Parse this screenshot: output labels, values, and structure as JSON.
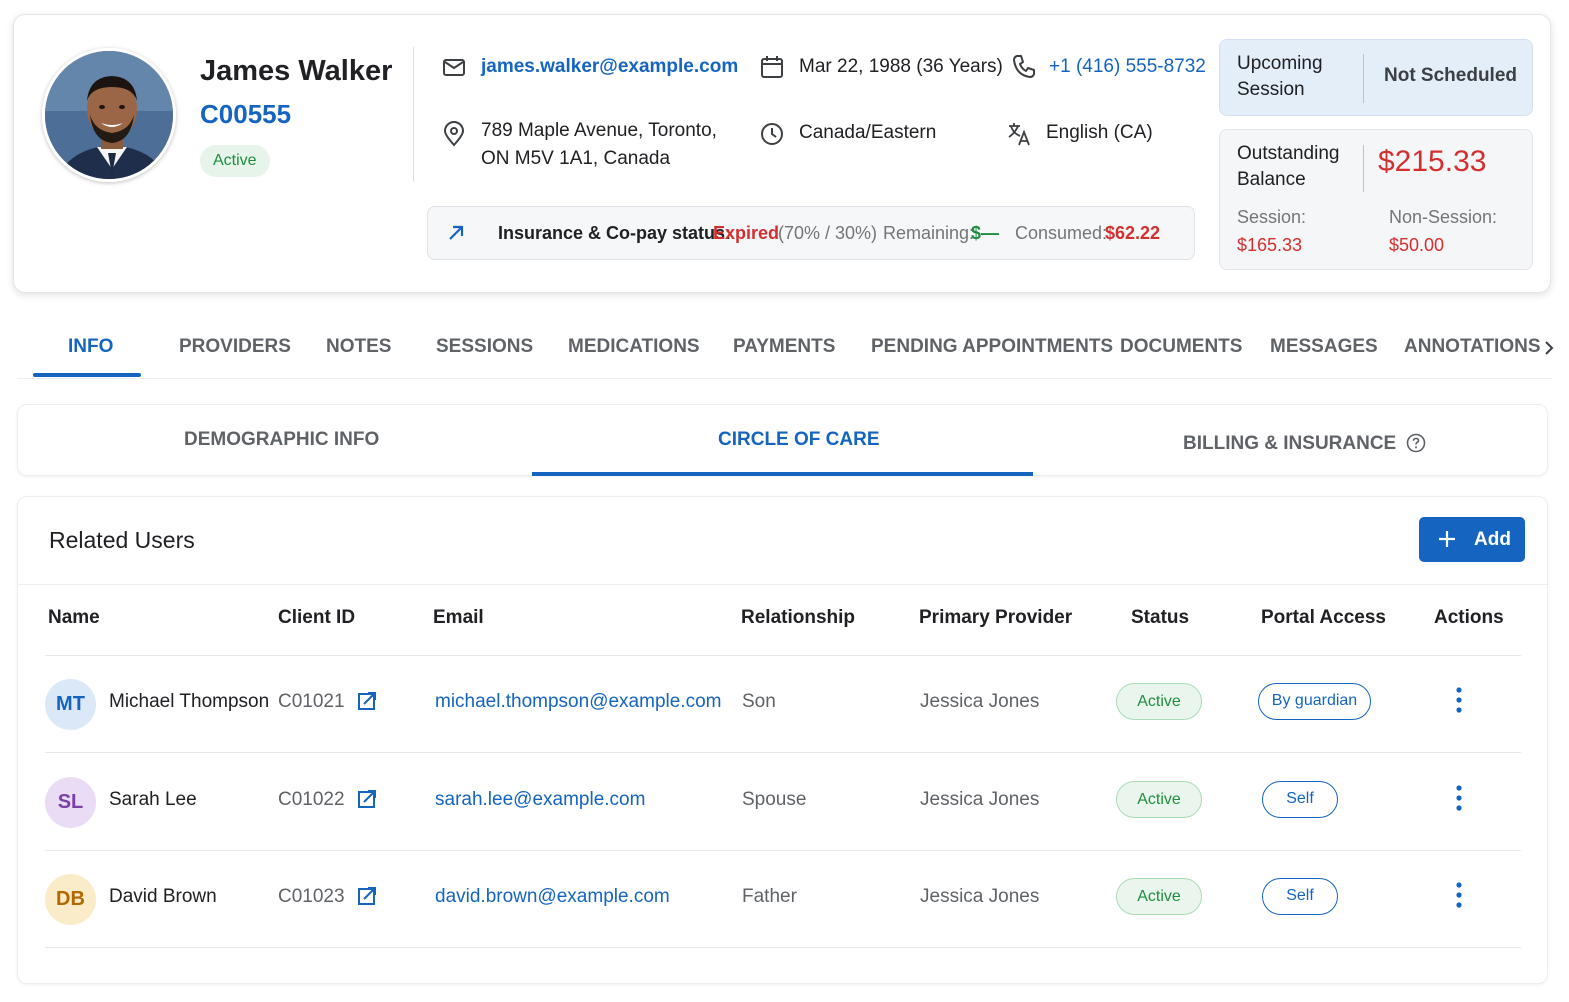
{
  "client": {
    "name": "James Walker",
    "code": "C00555",
    "status": "Active",
    "email": "james.walker@example.com",
    "dob": "Mar 22, 1988 (36 Years)",
    "phone": "+1 (416) 555-8732",
    "address_line1": "789 Maple Avenue, Toronto,",
    "address_line2": "ON M5V 1A1, Canada",
    "timezone": "Canada/Eastern",
    "language": "English (CA)"
  },
  "insurance": {
    "label": "Insurance & Co-pay status:",
    "status": "Expired",
    "ratio": "(70% / 30%)",
    "remaining_label": "Remaining:",
    "remaining_value": "$—",
    "consumed_label": "Consumed:",
    "consumed_value": "$62.22"
  },
  "upcoming": {
    "label_line1": "Upcoming",
    "label_line2": "Session",
    "value": "Not Scheduled"
  },
  "balance": {
    "label_line1": "Outstanding",
    "label_line2": "Balance",
    "value": "$215.33",
    "session_label": "Session:",
    "session_value": "$165.33",
    "non_session_label": "Non-Session:",
    "non_session_value": "$50.00"
  },
  "main_tabs": [
    "INFO",
    "PROVIDERS",
    "NOTES",
    "SESSIONS",
    "MEDICATIONS",
    "PAYMENTS",
    "PENDING APPOINTMENTS",
    "DOCUMENTS",
    "MESSAGES",
    "ANNOTATIONS"
  ],
  "sub_tabs": [
    "DEMOGRAPHIC INFO",
    "CIRCLE OF CARE",
    "BILLING & INSURANCE"
  ],
  "related_users": {
    "title": "Related Users",
    "add_label": "Add",
    "columns": [
      "Name",
      "Client ID",
      "Email",
      "Relationship",
      "Primary Provider",
      "Status",
      "Portal Access",
      "Actions"
    ],
    "rows": [
      {
        "initials": "MT",
        "name": "Michael Thompson",
        "client_id": "C01021",
        "email": "michael.thompson@example.com",
        "relationship": "Son",
        "provider": "Jessica Jones",
        "status": "Active",
        "portal": "By guardian",
        "avatar_bg": "#dbe8f7",
        "avatar_fg": "#1565c0"
      },
      {
        "initials": "SL",
        "name": "Sarah Lee",
        "client_id": "C01022",
        "email": "sarah.lee@example.com",
        "relationship": "Spouse",
        "provider": "Jessica Jones",
        "status": "Active",
        "portal": "Self",
        "avatar_bg": "#ebdcf5",
        "avatar_fg": "#7b3fa8"
      },
      {
        "initials": "DB",
        "name": "David Brown",
        "client_id": "C01023",
        "email": "david.brown@example.com",
        "relationship": "Father",
        "provider": "Jessica Jones",
        "status": "Active",
        "portal": "Self",
        "avatar_bg": "#fbecc9",
        "avatar_fg": "#b26a00"
      }
    ]
  },
  "colors": {
    "primary": "#1565c0",
    "danger": "#d32f2f",
    "success": "#1e8e3e"
  }
}
